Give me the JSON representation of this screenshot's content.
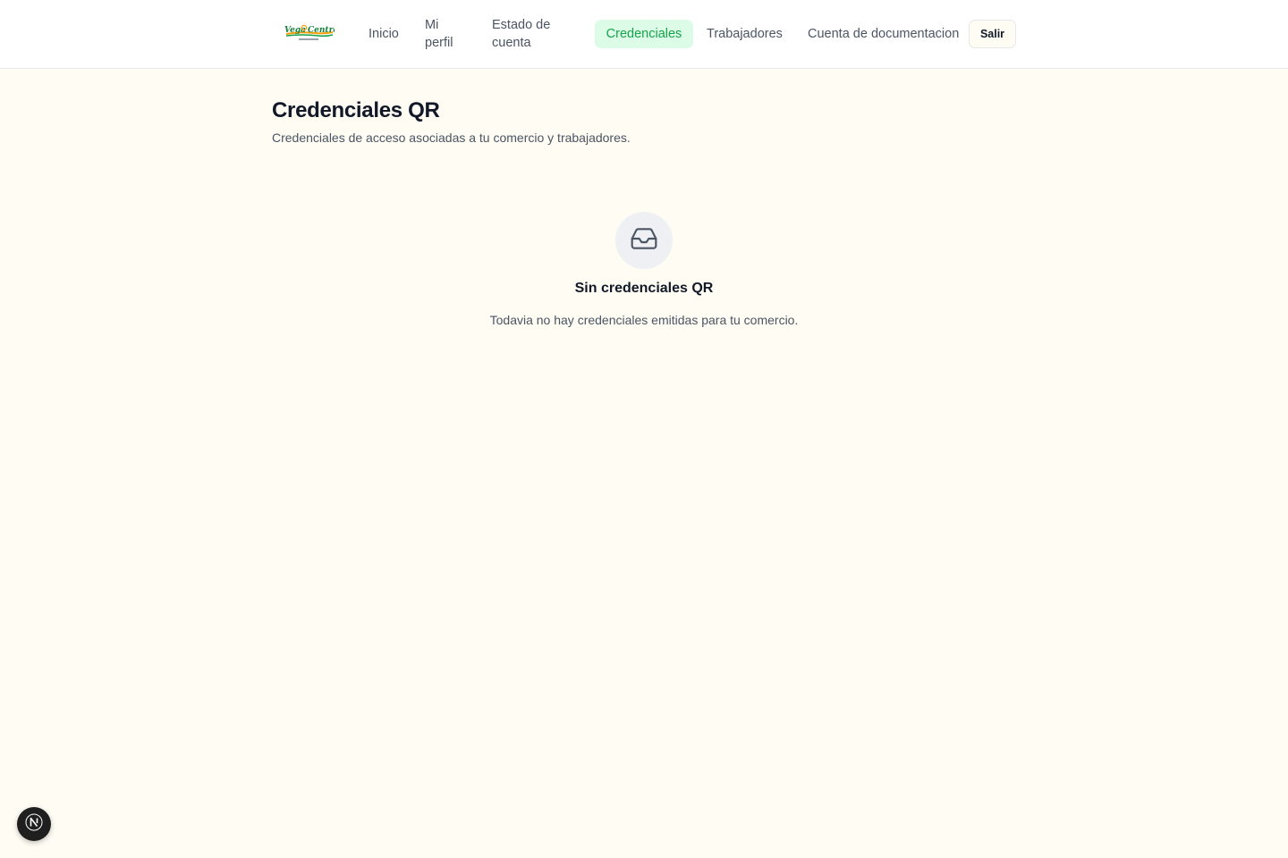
{
  "header": {
    "logo_text": "Vega Central",
    "nav": [
      {
        "label": "Inicio"
      },
      {
        "label": "Mi perfil"
      },
      {
        "label": "Estado de cuenta"
      },
      {
        "label": "Credenciales",
        "active": true
      },
      {
        "label": "Trabajadores"
      },
      {
        "label": "Cuenta de documentacion"
      }
    ],
    "logout_label": "Salir"
  },
  "page": {
    "title": "Credenciales QR",
    "subtitle": "Credenciales de acceso asociadas a tu comercio y trabajadores."
  },
  "empty_state": {
    "icon": "inbox-icon",
    "title": "Sin credenciales QR",
    "text": "Todavia no hay credenciales emitidas para tu comercio."
  },
  "dev_badge": {
    "icon": "nextjs-icon"
  },
  "colors": {
    "background": "#fefcf3",
    "active_nav_bg": "#dcfce7",
    "active_nav_text": "#16a34a",
    "text_primary": "#111827",
    "text_muted": "#4b5563"
  }
}
